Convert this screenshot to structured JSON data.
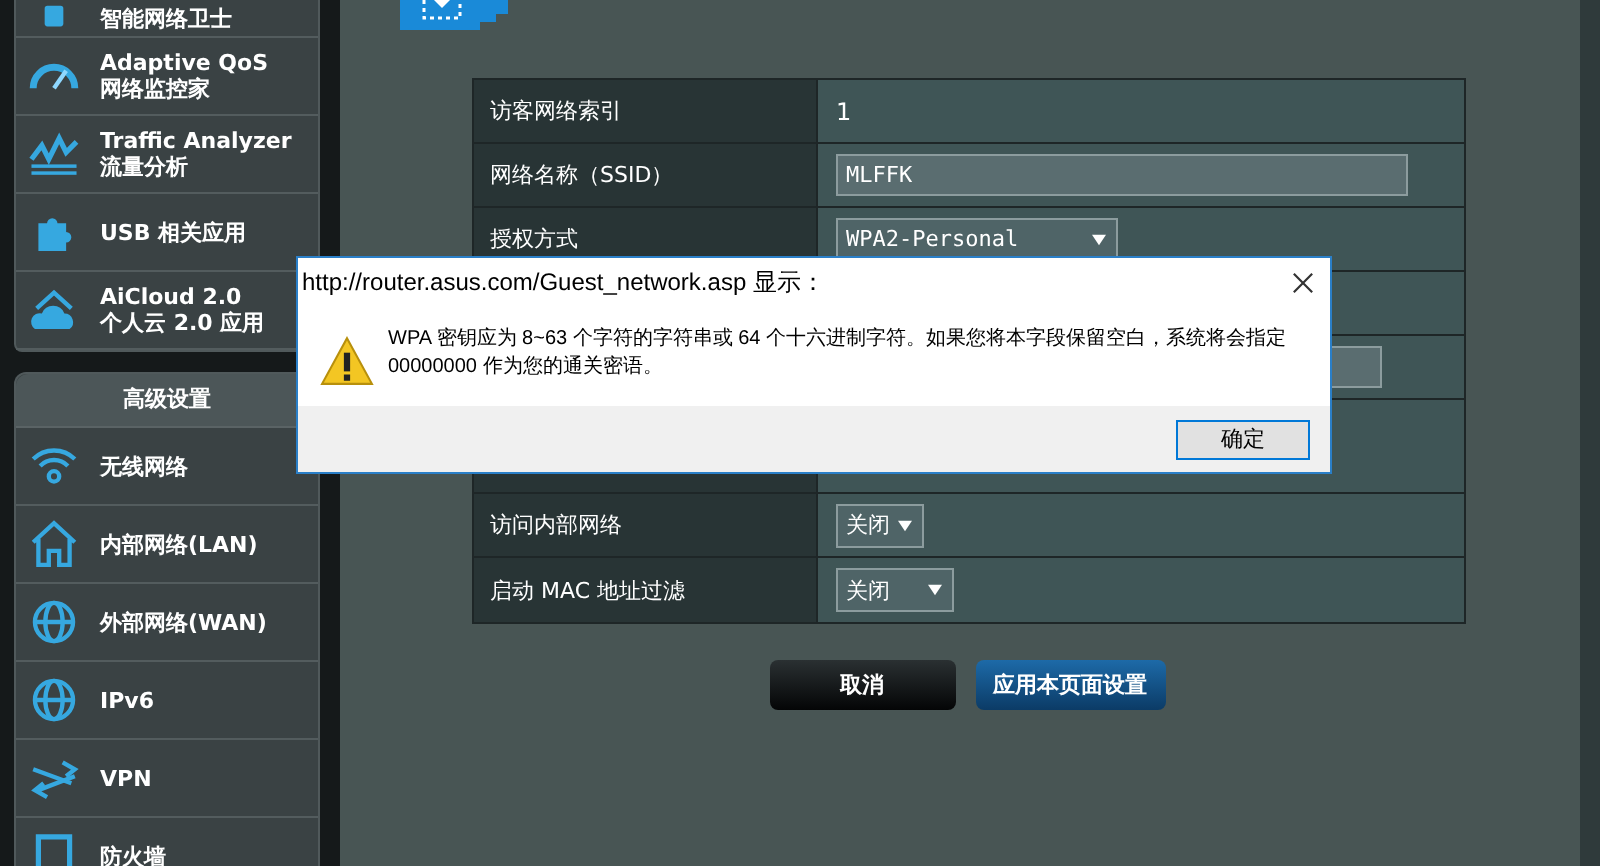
{
  "sidebar": {
    "items": [
      {
        "label": "智能网络卫士"
      },
      {
        "title": "Adaptive QoS",
        "label": "网络监控家"
      },
      {
        "title": "Traffic Analyzer",
        "label": "流量分析"
      },
      {
        "label": "USB 相关应用"
      },
      {
        "title": "AiCloud 2.0",
        "label": "个人云 2.0 应用"
      }
    ],
    "section": {
      "heading": "高级设置",
      "items": [
        {
          "label": "无线网络"
        },
        {
          "label": "内部网络(LAN)"
        },
        {
          "label": "外部网络(WAN)"
        },
        {
          "label": "IPv6"
        },
        {
          "label": "VPN"
        },
        {
          "label": "防火墙"
        }
      ]
    }
  },
  "form": {
    "rows": [
      {
        "kind": "text",
        "label": "访客网络索引",
        "value": "1"
      },
      {
        "kind": "input",
        "label": "网络名称（SSID）",
        "value": "MLFFK"
      },
      {
        "kind": "select",
        "label": "授权方式",
        "value": "WPA2-Personal"
      },
      {
        "kind": "covered"
      },
      {
        "kind": "covered_input"
      },
      {
        "kind": "covered_tall"
      },
      {
        "kind": "select",
        "label": "访问内部网络",
        "value": "关闭"
      },
      {
        "kind": "select",
        "label": "启动 MAC 地址过滤",
        "value": "关闭"
      }
    ],
    "buttons": [
      {
        "kind": "cancel",
        "label": "取消"
      },
      {
        "kind": "apply",
        "label": "应用本页面设置"
      }
    ]
  },
  "dialog": {
    "title": "http://router.asus.com/Guest_network.asp 显示：",
    "message": "WPA 密钥应为 8~63 个字符的字符串或 64 个十六进制字符。如果您将本字段保留空白，系统将会指定 00000000 作为您的通关密语。",
    "button": "确定"
  }
}
